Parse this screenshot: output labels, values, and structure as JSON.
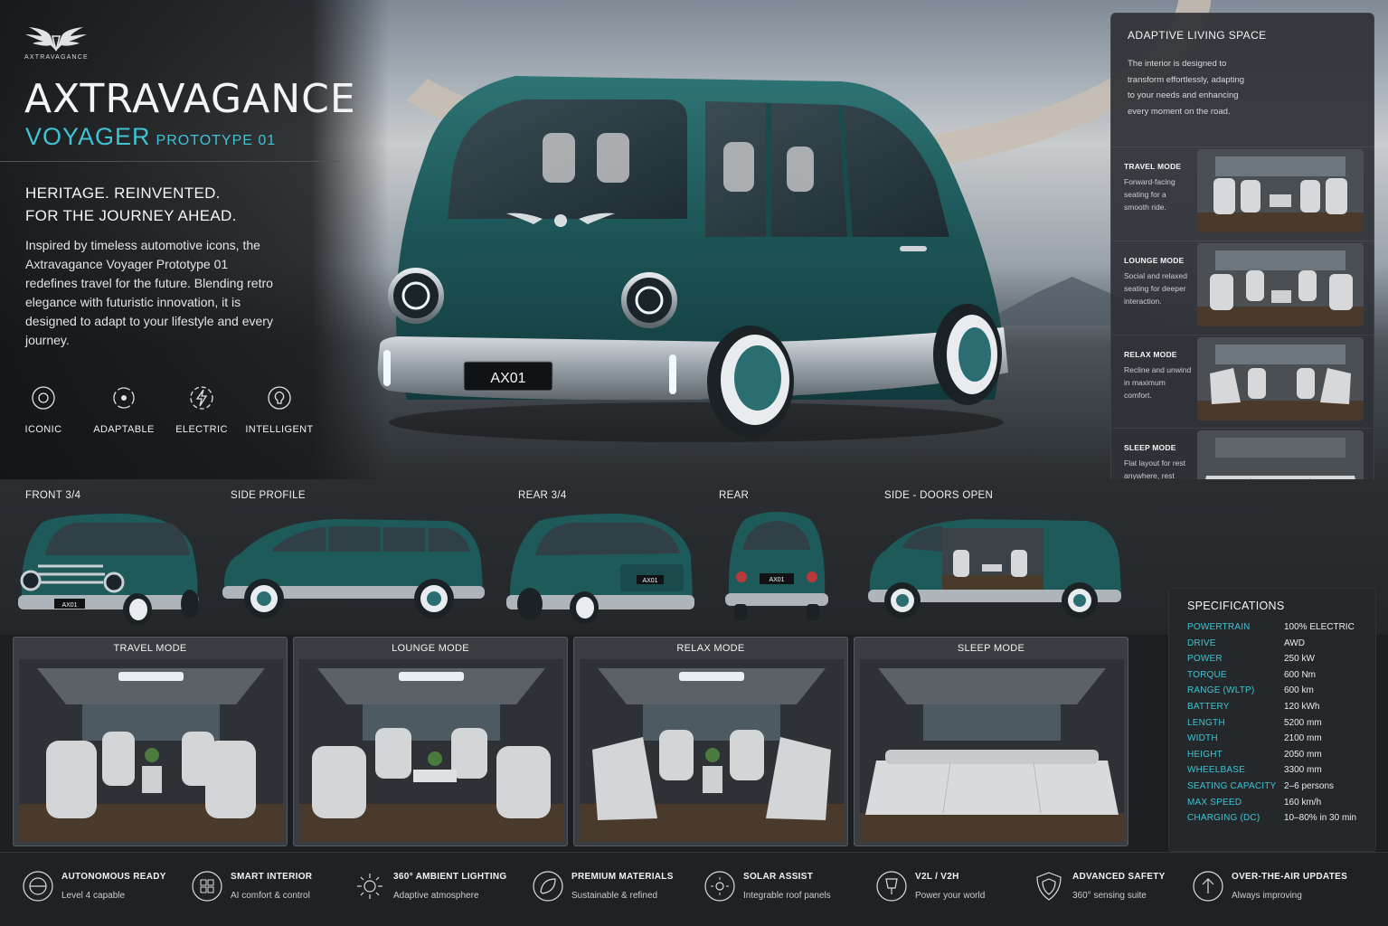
{
  "brand": {
    "logo_text": "AXTRAVAGANCE",
    "title": "AXTRAVAGANCE",
    "model": "VOYAGER",
    "model_sub": "PROTOTYPE 01"
  },
  "intro": {
    "tagline_line1": "HERITAGE. REINVENTED.",
    "tagline_line2": "FOR THE JOURNEY AHEAD.",
    "body": "Inspired by timeless automotive icons, the Axtravagance Voyager Prototype 01 redefines travel for the future. Blending retro elegance with futuristic innovation, it is designed to adapt to your lifestyle and every journey."
  },
  "features": [
    {
      "label": "ICONIC",
      "icon": "emblem-icon"
    },
    {
      "label": "ADAPTABLE",
      "icon": "adaptable-icon"
    },
    {
      "label": "ELECTRIC",
      "icon": "lightning-icon"
    },
    {
      "label": "INTELLIGENT",
      "icon": "brain-icon"
    }
  ],
  "hero": {
    "plate": "AX01"
  },
  "colors": {
    "accent": "#3fc3d3",
    "body": "#1f5a5a",
    "chrome": "#c9cfd4"
  },
  "adaptive": {
    "title": "ADAPTIVE LIVING SPACE",
    "body": "The interior is designed to transform effortlessly, adapting to your needs and enhancing every moment on the road.",
    "modes": [
      {
        "title": "TRAVEL MODE",
        "desc": "Forward-facing seating for a smooth ride."
      },
      {
        "title": "LOUNGE MODE",
        "desc": "Social and relaxed seating for deeper interaction."
      },
      {
        "title": "RELAX MODE",
        "desc": "Recline and unwind in maximum comfort."
      },
      {
        "title": "SLEEP MODE",
        "desc": "Flat layout for rest anywhere, rest anywhere, anytime."
      }
    ]
  },
  "views": [
    {
      "label": "FRONT 3/4",
      "plate": "AX01"
    },
    {
      "label": "SIDE PROFILE"
    },
    {
      "label": "REAR 3/4",
      "plate": "AX01"
    },
    {
      "label": "REAR",
      "plate": "AX01"
    },
    {
      "label": "SIDE - DOORS OPEN"
    }
  ],
  "interior_modes": [
    {
      "title": "TRAVEL MODE"
    },
    {
      "title": "LOUNGE MODE"
    },
    {
      "title": "RELAX MODE"
    },
    {
      "title": "SLEEP MODE"
    }
  ],
  "specs": {
    "title": "SPECIFICATIONS",
    "rows": [
      {
        "k": "POWERTRAIN",
        "v": "100% ELECTRIC"
      },
      {
        "k": "DRIVE",
        "v": "AWD"
      },
      {
        "k": "POWER",
        "v": "250 kW"
      },
      {
        "k": "TORQUE",
        "v": "600 Nm"
      },
      {
        "k": "RANGE (WLTP)",
        "v": "600 km"
      },
      {
        "k": "BATTERY",
        "v": "120 kWh"
      },
      {
        "k": "LENGTH",
        "v": "5200 mm"
      },
      {
        "k": "WIDTH",
        "v": "2100 mm"
      },
      {
        "k": "HEIGHT",
        "v": "2050 mm"
      },
      {
        "k": "WHEELBASE",
        "v": "3300 mm"
      },
      {
        "k": "SEATING CAPACITY",
        "v": "2–6 persons"
      },
      {
        "k": "MAX SPEED",
        "v": "160 km/h"
      },
      {
        "k": "CHARGING (DC)",
        "v": "10–80% in 30 min"
      }
    ]
  },
  "footer_features": [
    {
      "title": "AUTONOMOUS READY",
      "sub": "Level 4 capable",
      "icon": "steering-icon"
    },
    {
      "title": "SMART INTERIOR",
      "sub": "AI comfort & control",
      "icon": "grid-icon"
    },
    {
      "title": "360° AMBIENT LIGHTING",
      "sub": "Adaptive atmosphere",
      "icon": "sun-icon"
    },
    {
      "title": "PREMIUM MATERIALS",
      "sub": "Sustainable & refined",
      "icon": "leaf-icon"
    },
    {
      "title": "SOLAR ASSIST",
      "sub": "Integrable roof panels",
      "icon": "solar-icon"
    },
    {
      "title": "V2L / V2H",
      "sub": "Power your world",
      "icon": "plug-icon"
    },
    {
      "title": "ADVANCED SAFETY",
      "sub": "360° sensing suite",
      "icon": "shield-icon"
    },
    {
      "title": "OVER-THE-AIR UPDATES",
      "sub": "Always improving",
      "icon": "update-icon"
    }
  ]
}
